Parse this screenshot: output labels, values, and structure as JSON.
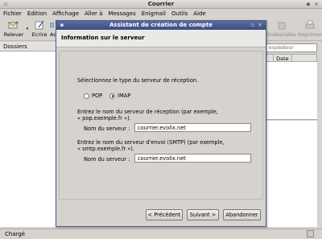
{
  "window": {
    "title": "Courrier"
  },
  "menu": [
    "Fichier",
    "Edition",
    "Affichage",
    "Aller à",
    "Messages",
    "Enigmail",
    "Outils",
    "Aide"
  ],
  "toolbar": {
    "relever": "Relever",
    "ecrire": "Ecrire",
    "truncated": "Ac",
    "indesirable": "Indésirable",
    "imprimer": "Imprimer"
  },
  "sidebar": {
    "header": "Dossiers"
  },
  "search": {
    "placeholder": "expéditeur"
  },
  "message_list": {
    "col_date": "Date"
  },
  "statusbar": {
    "text": "Chargé"
  },
  "dialog": {
    "title": "Assistant de création de compte",
    "header": "Information sur le serveur",
    "select_type_text": "Sélectionnez le type du serveur de réception.",
    "radio_pop": "POP",
    "radio_imap": "IMAP",
    "selected": "IMAP",
    "incoming_text_1": "Entrez le nom du serveur de réception (par exemple,",
    "incoming_text_2": "« pop.exemple.fr »).",
    "incoming_label": "Nom du serveur :",
    "incoming_value": "courrier.evolix.net",
    "outgoing_text_1": "Entrez le nom du serveur d'envoi (SMTP) (par exemple,",
    "outgoing_text_2": "« smtp.exemple.fr »).",
    "outgoing_label": "Nom du serveur :",
    "outgoing_value": "courrier.evolix.net",
    "btn_prev": "< Précédent",
    "btn_next": "Suivant >",
    "btn_cancel": "Abandonner"
  }
}
